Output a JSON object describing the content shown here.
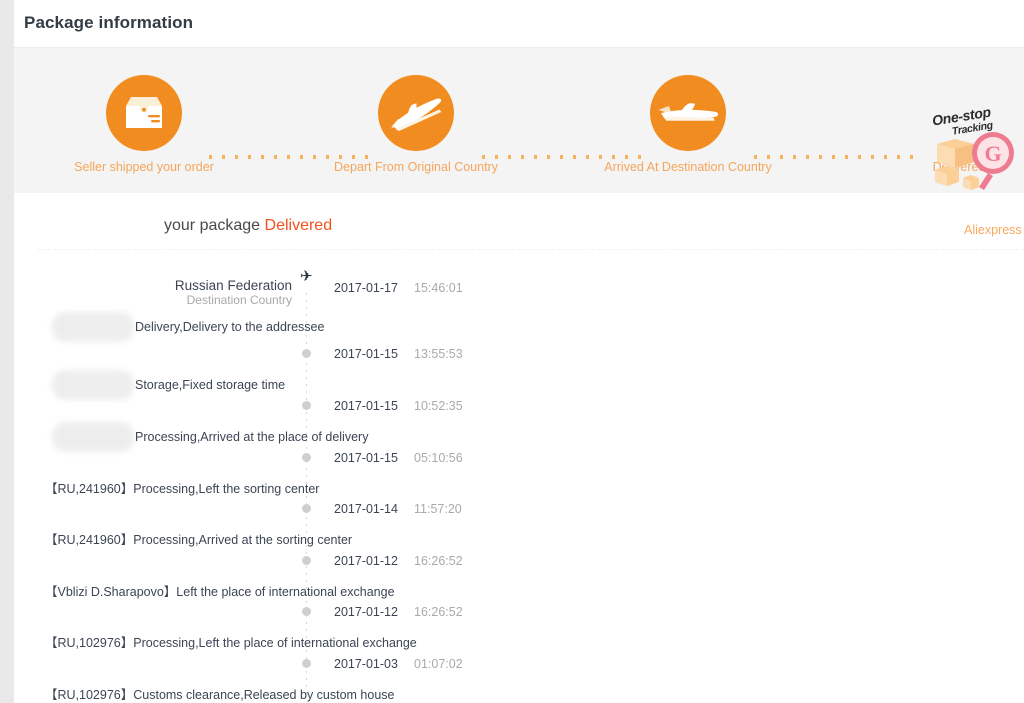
{
  "header": {
    "title": "Package information"
  },
  "progress": {
    "accent_color": "#f18d20",
    "label_color": "#f5a65a",
    "steps": [
      {
        "icon": "package-box-icon",
        "label": "Seller shipped your order"
      },
      {
        "icon": "airplane-departure-icon",
        "label": "Depart From Original Country"
      },
      {
        "icon": "airplane-arrival-icon",
        "label": "Arrived At Destination Country"
      },
      {
        "icon": "delivered-icon",
        "label": "Delivered"
      }
    ],
    "watermark": {
      "line1": "One-stop",
      "line2": "Tracking",
      "mark_letter": "G"
    }
  },
  "tracking": {
    "status_prefix": "your package ",
    "status_value": "Delivered",
    "status_color": "#f4511e",
    "carrier_link": "Aliexpress S",
    "origin": {
      "country": "Russian Federation",
      "subtitle": "Destination Country",
      "date": "2017-01-17",
      "time": "15:46:01"
    },
    "events": [
      {
        "date": "2017-01-17",
        "time": "15:46:01",
        "description": "Delivery,Delivery to the addressee",
        "location": "",
        "redacted": true
      },
      {
        "date": "2017-01-15",
        "time": "13:55:53",
        "description": "Storage,Fixed storage time",
        "location": "",
        "redacted": true
      },
      {
        "date": "2017-01-15",
        "time": "10:52:35",
        "description": "Processing,Arrived at the place of delivery",
        "location": "",
        "redacted": true
      },
      {
        "date": "2017-01-15",
        "time": "05:10:56",
        "description": "【RU,241960】Processing,Left the sorting center",
        "location": "",
        "redacted": false
      },
      {
        "date": "2017-01-14",
        "time": "11:57:20",
        "description": "【RU,241960】Processing,Arrived at the sorting center",
        "location": "",
        "redacted": false
      },
      {
        "date": "2017-01-12",
        "time": "16:26:52",
        "description": "【Vblizi D.Sharapovo】Left the place of international exchange",
        "location": "",
        "redacted": false
      },
      {
        "date": "2017-01-12",
        "time": "16:26:52",
        "description": "【RU,102976】Processing,Left the place of international exchange",
        "location": "",
        "redacted": false
      },
      {
        "date": "2017-01-03",
        "time": "01:07:02",
        "description": "【RU,102976】Customs clearance,Released by custom house",
        "location": "",
        "redacted": false
      }
    ]
  }
}
